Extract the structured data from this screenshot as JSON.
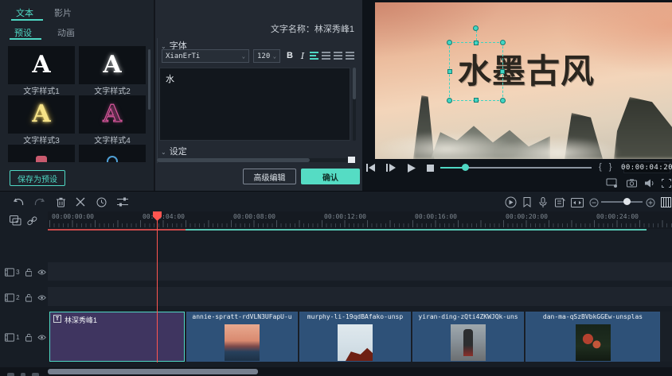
{
  "accent_color": "#4fd8c4",
  "left_panel": {
    "tabs": [
      {
        "label": "文本",
        "active": true
      },
      {
        "label": "影片",
        "active": false
      }
    ],
    "sub_tabs": [
      {
        "label": "预设",
        "active": true
      },
      {
        "label": "动画",
        "active": false
      }
    ],
    "style_preview_glyph": "A",
    "styles": [
      {
        "label": "文字样式1"
      },
      {
        "label": "文字样式2"
      },
      {
        "label": "文字样式3"
      },
      {
        "label": "文字样式4"
      }
    ],
    "save_preset_button": "保存为预设"
  },
  "editor": {
    "title_name": "文字名称：林深秀峰1",
    "font_section_header": "字体",
    "font_family": "XianErTi",
    "font_size": "120",
    "bold_label": "B",
    "italic_label": "I",
    "text_content": "水",
    "settings_header": "设定",
    "advanced_edit_button": "高级编辑",
    "confirm_button": "确认"
  },
  "preview": {
    "overlay_title": "水墨古风",
    "brackets": "{ }",
    "timecode": "00:00:04:20"
  },
  "timeline": {
    "ruler": [
      "00:00:00:00",
      "00:00:04:00",
      "00:00:08:00",
      "00:00:12:00",
      "00:00:16:00",
      "00:00:20:00",
      "00:00:24:00"
    ],
    "tracks": [
      {
        "number": "3"
      },
      {
        "number": "2"
      },
      {
        "number": "1"
      }
    ],
    "clips": {
      "title": {
        "badge": "T",
        "label": "林深秀峰1"
      },
      "c2": {
        "label": "annie-spratt-rdVLN3UFapU-u"
      },
      "c3": {
        "label": "murphy-li-19qdBAfako-unsp"
      },
      "c4": {
        "label": "yiran-ding-zQti4ZKWJQk-uns"
      },
      "c5": {
        "label": "dan-ma-qSzBVbkGGEw-unsplas"
      }
    }
  }
}
